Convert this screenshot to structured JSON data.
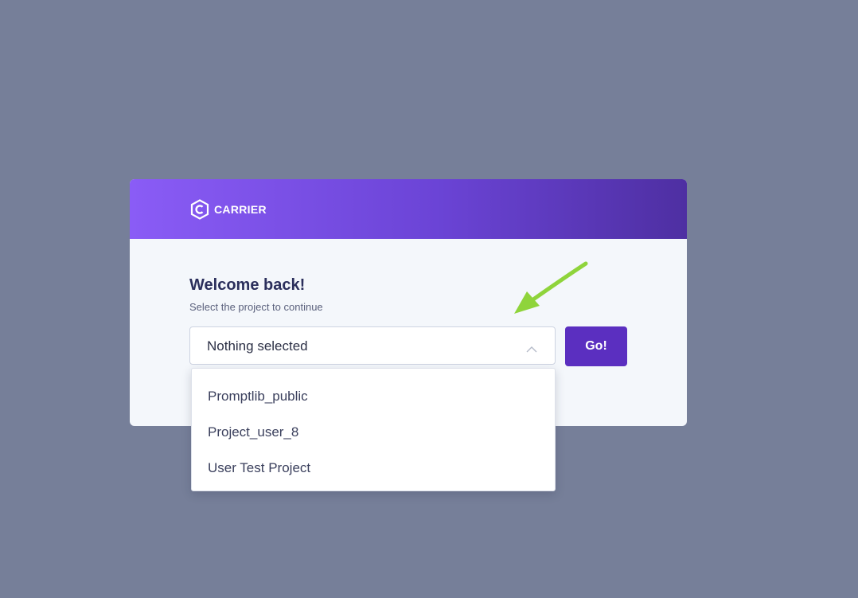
{
  "header": {
    "logo_text": "CARRIER",
    "gradient_colors": [
      "#8a5cf6",
      "#6b44d6",
      "#4e2fa2"
    ]
  },
  "welcome": {
    "title": "Welcome back!",
    "subtitle": "Select the project to continue"
  },
  "project_select": {
    "value": "Nothing selected",
    "options": [
      "Promptlib_public",
      "Project_user_8",
      "User Test Project"
    ]
  },
  "go_button": {
    "label": "Go!",
    "color": "#5b2fc0"
  },
  "background_color": "#767f99",
  "annotation": {
    "icon": "green-arrow-icon",
    "color": "#8fd43b"
  }
}
